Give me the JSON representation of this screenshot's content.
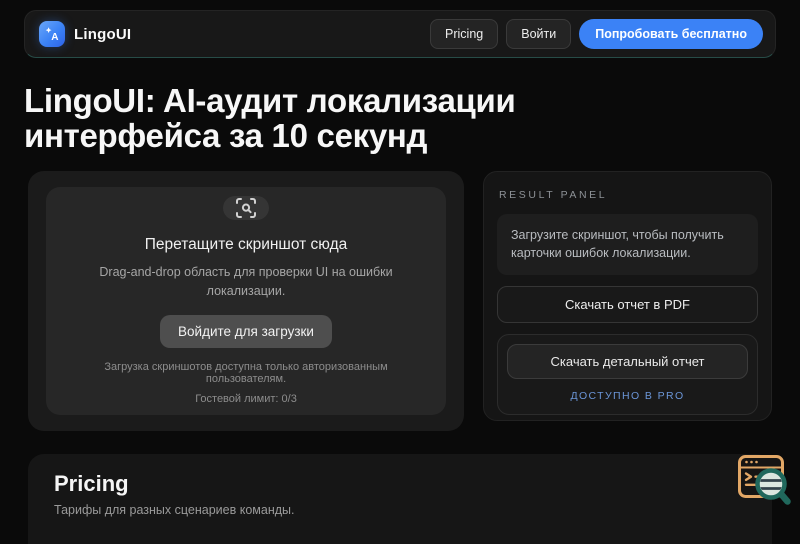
{
  "brand": {
    "name": "LingoUI"
  },
  "navbar": {
    "links": [
      {
        "label": "Pricing"
      },
      {
        "label": "Войти"
      }
    ],
    "cta_label": "Попробовать бесплатно"
  },
  "hero": {
    "title": "LingoUI: AI-аудит локализации\nинтерфейса за 10 секунд"
  },
  "dropzone": {
    "title": "Перетащите скриншот сюда",
    "description": "Drag-and-drop область для проверки UI на ошибки локализации.",
    "login_button": "Войдите для загрузки",
    "note": "Загрузка скриншотов доступна только авторизованным пользователям.",
    "guest_limit": "Гостевой лимит: 0/3"
  },
  "result_panel": {
    "label": "RESULT PANEL",
    "empty_message": "Загрузите скриншот, чтобы получить карточки ошибок локализации.",
    "pdf_button": "Скачать отчет в PDF",
    "detailed_button": "Скачать детальный отчет",
    "pro_badge": "ДОСТУПНО В PRO"
  },
  "pricing": {
    "title": "Pricing",
    "subtitle": "Тарифы для разных сценариев команды."
  },
  "icons": {
    "logo": "translate-sparkle-icon",
    "dropzone": "scan-search-icon",
    "corner": "browser-search-icon"
  },
  "colors": {
    "page_bg": "#0a0a0a",
    "navbar_bg": "#181818",
    "accent_blue": "#3b82f6",
    "pro_text_blue": "#6b96d8",
    "navbar_accent_teal": "#46afa0",
    "mascot_orange": "#e2a766",
    "mascot_teal": "#20685c"
  }
}
